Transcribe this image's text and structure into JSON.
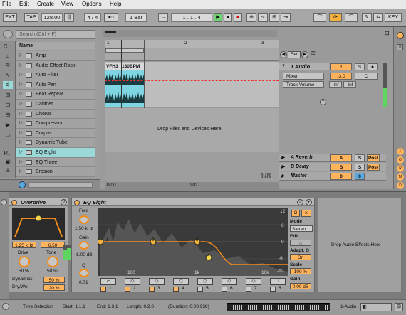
{
  "menubar": {
    "items": [
      "File",
      "Edit",
      "Create",
      "View",
      "Options",
      "Help"
    ]
  },
  "transport": {
    "ext": "EXT",
    "tap": "TAP",
    "tempo": "128.00",
    "time_sig": "4 / 4",
    "metro": "●○",
    "quant": "1 Bar",
    "position": "1 .   1 .   4",
    "key": "KEY",
    "follow": "→"
  },
  "browser": {
    "search_placeholder": "Search (Ctrl + F)",
    "header": "Name",
    "items": [
      "Amp",
      "Audio Effect Rack",
      "Auto Filter",
      "Auto Pan",
      "Beat Repeat",
      "Cabinet",
      "Chorus",
      "Compressor",
      "Corpus",
      "Dynamic Tube",
      "EQ Eight",
      "EQ Three",
      "Erosion"
    ],
    "selected": "EQ Eight",
    "categories": [
      "C...",
      "P..."
    ]
  },
  "arrangement": {
    "ruler": [
      "1",
      "2",
      "3"
    ],
    "clip_title": "VFH3 _130BPM",
    "drop_text": "Drop Files and Devices Here",
    "fraction": "1/8",
    "time_left": "0:00",
    "time_mid": "0:02",
    "set_btn": "Set"
  },
  "mixer": {
    "track_name": "1 Audio",
    "track_num": "1",
    "solo": "S",
    "mixer_sel": "Mixer",
    "vol_sel": "Track Volume",
    "vol_val": "-3.0",
    "pan_val": "C",
    "inf1": "-inf",
    "inf2": "-inf",
    "returns": [
      {
        "name": "A Reverb",
        "letter": "A",
        "solo": "S",
        "post": "Post"
      },
      {
        "name": "B Delay",
        "letter": "B",
        "solo": "S",
        "post": "Post"
      },
      {
        "name": "Master",
        "letter": "0",
        "solo": "0",
        "post": ""
      }
    ],
    "side_labels": [
      "I",
      "O",
      "R",
      "M",
      "D"
    ]
  },
  "overdrive": {
    "title": "Overdrive",
    "freq": "1.25 kHz",
    "width": "6.50",
    "drive_label": "Drive",
    "drive_val": "50 %",
    "tone_label": "Tone",
    "tone_val": "50 %",
    "dynamics_label": "Dynamics",
    "dynamics_val": "50 %",
    "drywet_label": "Dry/Wet",
    "drywet_val": "20 %"
  },
  "eq8": {
    "title": "EQ Eight",
    "freq_label": "Freq",
    "freq_val": "1.50 kHz",
    "gain_label": "Gain",
    "gain_val": "-8.00 dB",
    "q_label": "Q",
    "q_val": "0.71",
    "db_labels": [
      "12",
      "6",
      "0",
      "-6",
      "-12"
    ],
    "freq_axis": [
      "100",
      "1k",
      "10k"
    ],
    "mode_label": "Mode",
    "mode_val": "Stereo",
    "edit_label": "Edit",
    "edit_val": "A",
    "adapt_label": "Adapt. Q",
    "adapt_val": "On",
    "scale_label": "Scale",
    "scale_val": "100 %",
    "gain2_label": "Gain",
    "gain2_val": "0.00 dB",
    "bands": [
      "1",
      "2",
      "3",
      "4",
      "5",
      "6",
      "7",
      "8"
    ]
  },
  "device_drop": "Drop Audio Effects Here",
  "status": {
    "sel": "Time Selection",
    "start": "Start: 1.1.1",
    "end": "End: 1.3.1",
    "length": "Length: 0.2.0",
    "duration": "(Duration: 0:00:938)",
    "track": "1-Audio"
  }
}
